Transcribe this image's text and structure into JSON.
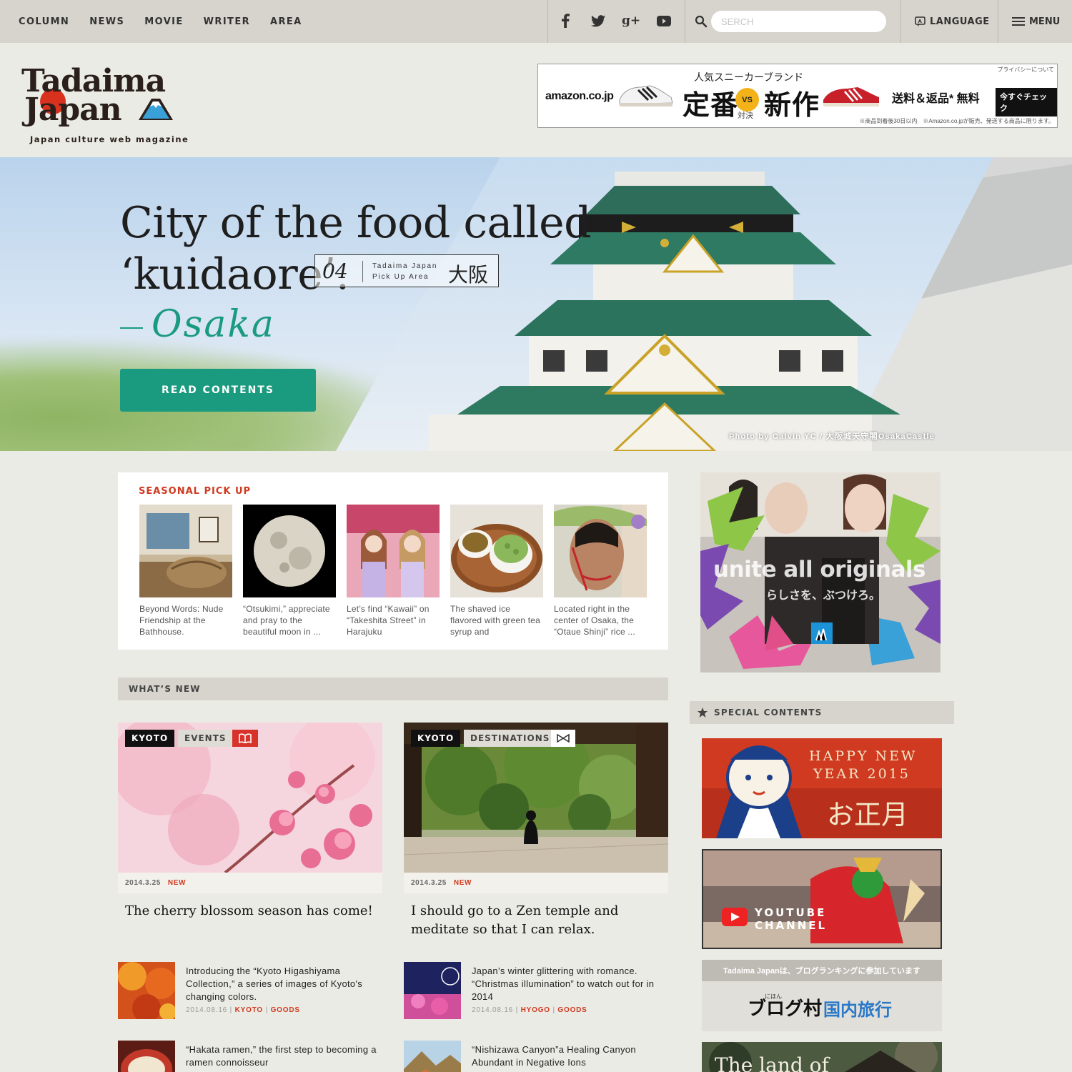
{
  "nav": {
    "items": [
      "COLUMN",
      "NEWS",
      "MOVIE",
      "WRITER",
      "AREA"
    ],
    "search_placeholder": "SERCH",
    "language_label": "LANGUAGE",
    "menu_label": "MENU"
  },
  "logo": {
    "line1": "Tadaima",
    "line2": "Japan",
    "tagline": "Japan culture web magazine"
  },
  "amazon_ad": {
    "brand": "amazon.co.jp",
    "privacy": "プライバシーについて",
    "headline_top": "人気スニーカーブランド",
    "headline_left": "定番",
    "vs": "VS",
    "headline_right": "新作",
    "subtitle": "対決",
    "shipping": "送料＆返品* 無料",
    "cta": "今すぐチェック",
    "footnote": "※商品到着後30日以内　※Amazon.co.jpが販売、発送する商品に限ります。"
  },
  "hero": {
    "title_line1": "City of the food called",
    "title_line2": "‘kuidaore’.",
    "badge_number": "04",
    "badge_label_line1": "Tadaima Japan",
    "badge_label_line2": "Pick Up Area",
    "badge_city_jp": "大阪",
    "city": "Osaka",
    "button_label": "READ CONTENTS",
    "photo_credit": "Photo by Calvin YC / 大阪城天守閣OsakaCastle"
  },
  "seasonal": {
    "heading": "SEASONAL PICK UP",
    "items": [
      {
        "caption": "Beyond Words: Nude Friendship at the Bathhouse."
      },
      {
        "caption": "“Otsukimi,” appreciate and pray to the beautiful moon in ..."
      },
      {
        "caption": "Let’s find “Kawaii” on “Takeshita Street” in Harajuku"
      },
      {
        "caption": "The shaved ice flavored with green tea syrup and"
      },
      {
        "caption": "Located right in the center of Osaka, the “Otaue Shinji” rice ..."
      }
    ]
  },
  "whats_new": {
    "heading": "WHAT’S NEW",
    "cards": [
      {
        "area": "KYOTO",
        "category": "EVENTS",
        "date": "2014.3.25",
        "badge": "NEW",
        "title": "The cherry blossom season has come!"
      },
      {
        "area": "KYOTO",
        "category": "DESTINATIONS",
        "date": "2014.3.25",
        "badge": "NEW",
        "title": "I should go to a Zen temple and meditate so that I can relax."
      }
    ],
    "list": [
      {
        "title": "Introducing the “Kyoto Higashiyama Collection,” a series of images of Kyoto's changing colors.",
        "date": "2014.08.16",
        "area": "KYOTO",
        "category": "GOODS"
      },
      {
        "title": "Japan’s winter glittering with romance. “Christmas illumination” to watch out for in 2014",
        "date": "2014.08.16",
        "area": "HYOGO",
        "category": "GOODS"
      },
      {
        "title": "“Hakata ramen,” the first step to becoming a ramen connoisseur",
        "date": "",
        "area": "",
        "category": ""
      },
      {
        "title": "“Nishizawa Canyon”a Healing Canyon Abundant in Negative Ions",
        "date": "",
        "area": "",
        "category": ""
      }
    ]
  },
  "sidebar": {
    "adidas_headline": "unite all originals",
    "adidas_sub": "らしさを、ぶつけろ。",
    "special_heading": "SPECIAL CONTENTS",
    "newyear_line1": "HAPPY NEW",
    "newyear_line2": "YEAR 2015",
    "newyear_jp": "お正月",
    "youtube_line1": "YOUTUBE",
    "youtube_line2": "CHANNEL",
    "ranking_text": "Tadaima Japanは、ブログランキングに参加しています",
    "ranking_site": "ブログ村",
    "ranking_site_small": "にほん",
    "ranking_category": "国内旅行",
    "land_title": "The land of"
  },
  "colors": {
    "accent_green": "#1a9a7e",
    "accent_red": "#cf3a20",
    "topbar": "#d6d4cc",
    "page_bg": "#ebebe5"
  }
}
